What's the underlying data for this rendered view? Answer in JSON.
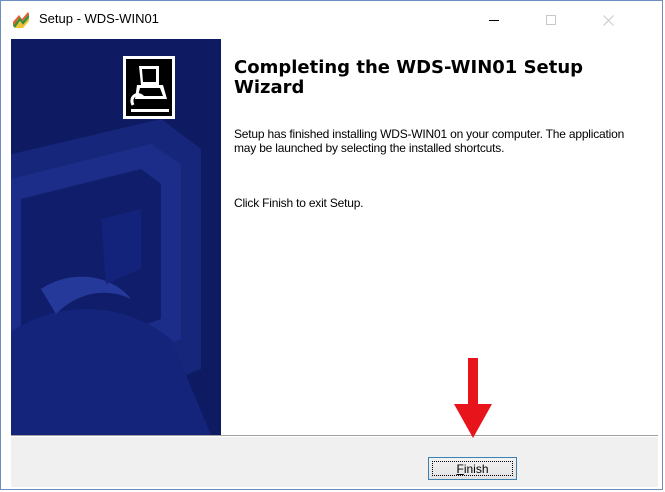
{
  "window": {
    "title": "Setup - WDS-WIN01",
    "controls": {
      "minimize": "minimize",
      "maximize": "maximize",
      "close": "close"
    }
  },
  "wizard": {
    "heading": "Completing the WDS-WIN01 Setup Wizard",
    "paragraph1": "Setup has finished installing WDS-WIN01 on your computer. The application may be launched by selecting the installed shortcuts.",
    "paragraph2": "Click Finish to exit Setup."
  },
  "buttons": {
    "finish_accel": "F",
    "finish_rest": "inish"
  },
  "colors": {
    "sidebar_bg": "#0e1b63",
    "annotation_arrow": "#e8141b",
    "button_border": "#3c7fb1"
  },
  "icons": {
    "app": "setup-installer-icon",
    "wizard": "computer-install-icon",
    "annotation": "red-down-arrow"
  }
}
